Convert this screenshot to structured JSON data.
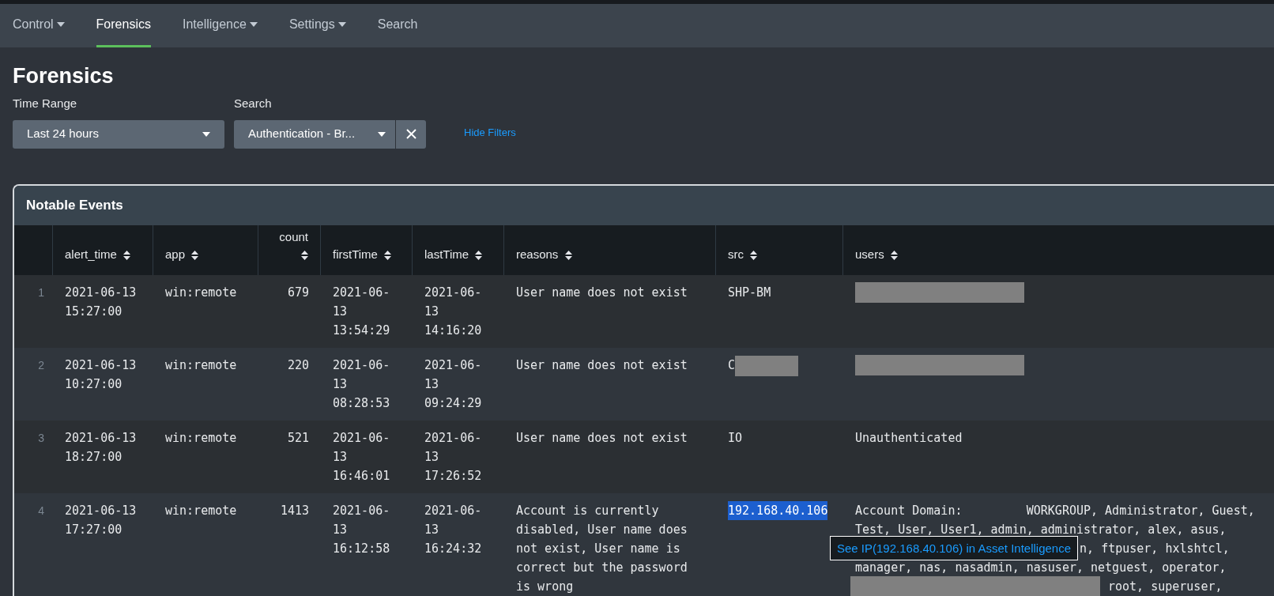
{
  "nav": [
    {
      "label": "Control",
      "dropdown": true,
      "selected": false
    },
    {
      "label": "Forensics",
      "dropdown": false,
      "selected": true
    },
    {
      "label": "Intelligence",
      "dropdown": true,
      "selected": false
    },
    {
      "label": "Settings",
      "dropdown": true,
      "selected": false
    },
    {
      "label": "Search",
      "dropdown": false,
      "selected": false
    }
  ],
  "page_title": "Forensics",
  "filters": {
    "time_range": {
      "label": "Time Range",
      "value": "Last 24 hours"
    },
    "search": {
      "label": "Search",
      "value": "Authentication - Br..."
    },
    "hide_link": "Hide Filters"
  },
  "panel": {
    "title": "Notable Events",
    "columns": [
      {
        "label": "alert_time",
        "kind": "text"
      },
      {
        "label": "app",
        "kind": "text"
      },
      {
        "label": "count",
        "kind": "number"
      },
      {
        "label": "firstTime",
        "kind": "text"
      },
      {
        "label": "lastTime",
        "kind": "text"
      },
      {
        "label": "reasons",
        "kind": "text"
      },
      {
        "label": "src",
        "kind": "text"
      },
      {
        "label": "users",
        "kind": "text"
      }
    ],
    "rows": [
      {
        "index": "1",
        "alert_time": "2021-06-13 15:27:00",
        "app": "win:remote",
        "count": "679",
        "firstTime": "2021-06-13 13:54:29",
        "lastTime": "2021-06-13 14:16:20",
        "reasons": "User name does not exist",
        "src": {
          "text": "SHP-BM",
          "redacted": false,
          "highlighted": false
        },
        "users": [
          {
            "redacted": true
          }
        ]
      },
      {
        "index": "2",
        "alert_time": "2021-06-13 10:27:00",
        "app": "win:remote",
        "count": "220",
        "firstTime": "2021-06-13 08:28:53",
        "lastTime": "2021-06-13 09:24:29",
        "reasons": "User name does not exist",
        "src": {
          "text": "C",
          "redacted": true,
          "highlighted": false
        },
        "users": [
          {
            "redacted": true
          }
        ]
      },
      {
        "index": "3",
        "alert_time": "2021-06-13 18:27:00",
        "app": "win:remote",
        "count": "521",
        "firstTime": "2021-06-13 16:46:01",
        "lastTime": "2021-06-13 17:26:52",
        "reasons": "User name does not exist",
        "src": {
          "text": "IO",
          "redacted": false,
          "highlighted": false
        },
        "users": [
          {
            "text": "Unauthenticated",
            "redacted": false
          }
        ]
      },
      {
        "index": "4",
        "alert_time": "2021-06-13 17:27:00",
        "app": "win:remote",
        "count": "1413",
        "firstTime": "2021-06-13 16:12:58",
        "lastTime": "2021-06-13 16:24:32",
        "reasons": "Account is currently disabled, User name does not exist, User name is correct but the password is wrong",
        "src": {
          "text": "192.168.40.106",
          "redacted": false,
          "highlighted": true
        },
        "users": [
          {
            "text": "Account Domain:         WORKGROUP, Administrator, Guest,",
            "redacted": false
          },
          {
            "text": "Test, User, User1, admin, administrator, alex, asus,",
            "redacted": false
          },
          {
            "text": "n, ftpuser, hxlshtcl,",
            "redacted": false,
            "tooltip": "See IP(192.168.40.106) in Asset Intelligence"
          },
          {
            "text": "manager, nas, nasadmin, nasuser, netguest, operator,",
            "redacted": false
          },
          {
            "text": "root, superuser,",
            "redacted": true
          }
        ]
      }
    ]
  }
}
